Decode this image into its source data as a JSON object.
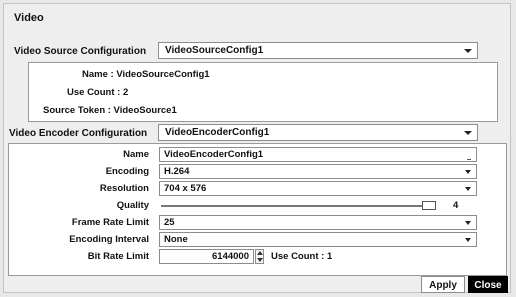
{
  "window": {
    "title": "Video"
  },
  "source": {
    "section_label": "Video Source Configuration",
    "selected": "VideoSourceConfig1",
    "name_line": "Name : VideoSourceConfig1",
    "use_count_line": "Use Count : 2",
    "token_line": "Source Token : VideoSource1"
  },
  "encoder": {
    "section_label": "Video Encoder Configuration",
    "selected": "VideoEncoderConfig1",
    "fields": {
      "name": {
        "label": "Name",
        "value": "VideoEncoderConfig1"
      },
      "encoding": {
        "label": "Encoding",
        "value": "H.264"
      },
      "resolution": {
        "label": "Resolution",
        "value": "704 x 576"
      },
      "quality": {
        "label": "Quality",
        "value": "4",
        "level": 1.0
      },
      "frame_rate_limit": {
        "label": "Frame Rate Limit",
        "value": "25"
      },
      "encoding_interval": {
        "label": "Encoding Interval",
        "value": "None"
      },
      "bit_rate_limit": {
        "label": "Bit Rate Limit",
        "value": "6144000",
        "use_count": "Use Count : 1"
      }
    }
  },
  "buttons": {
    "apply": "Apply",
    "close": "Close"
  }
}
